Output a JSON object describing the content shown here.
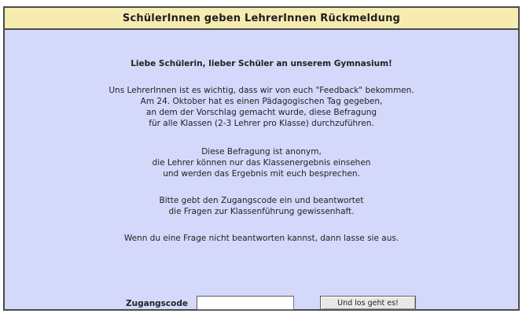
{
  "header": {
    "title": "SchülerInnen geben LehrerInnen Rückmeldung"
  },
  "intro": {
    "greeting": "Liebe Schülerin, lieber Schüler an unserem Gymnasium!"
  },
  "paragraph_feedback": {
    "lines": [
      "Uns LehrerInnen ist es wichtig, dass wir von euch \"Feedback\" bekommen.",
      "Am 24. Oktober hat es einen Pädagogischen Tag gegeben,",
      "an dem der Vorschlag gemacht wurde, diese Befragung",
      "für alle Klassen (2-3 Lehrer pro Klasse) durchzuführen."
    ]
  },
  "paragraph_anonymous": {
    "lines": [
      "Diese Befragung ist anonym,",
      "die Lehrer können nur das Klassenergebnis einsehen",
      "und werden das Ergebnis mit euch besprechen."
    ]
  },
  "paragraph_instructions": {
    "lines": [
      "Bitte gebt den Zugangscode ein und beantwortet",
      "die Fragen zur Klassenführung gewissenhaft."
    ]
  },
  "paragraph_skip": {
    "line": "Wenn du eine Frage nicht beantworten kannst, dann lasse sie aus."
  },
  "access": {
    "label": "Zugangscode",
    "value": "",
    "placeholder": "",
    "submit_label": "Und los geht es!"
  },
  "colors": {
    "background": "#d4d9fb",
    "title_bar": "#f6ecb2",
    "border": "#4a4a4a"
  }
}
